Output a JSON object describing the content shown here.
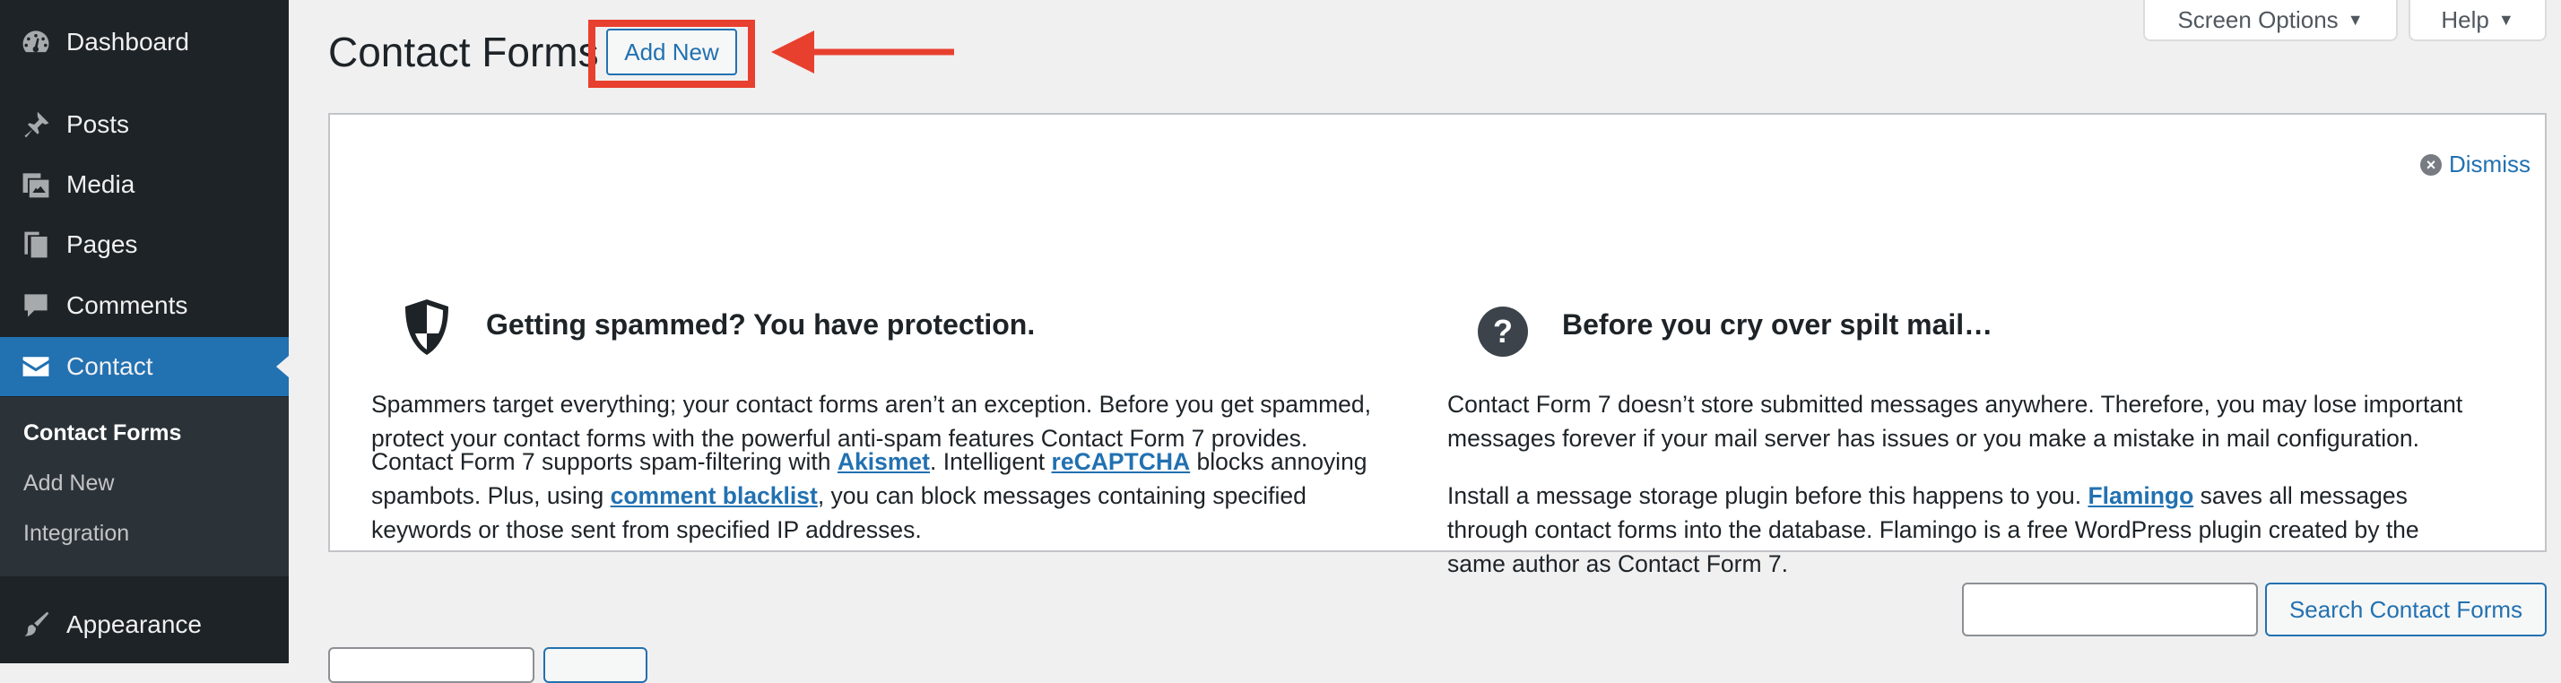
{
  "sidebar": {
    "items": [
      {
        "label": "Dashboard",
        "icon": "dashboard-icon"
      },
      {
        "label": "Posts",
        "icon": "pin-icon"
      },
      {
        "label": "Media",
        "icon": "media-icon"
      },
      {
        "label": "Pages",
        "icon": "pages-icon"
      },
      {
        "label": "Comments",
        "icon": "comment-icon"
      },
      {
        "label": "Contact",
        "icon": "mail-icon"
      },
      {
        "label": "Appearance",
        "icon": "brush-icon"
      }
    ],
    "submenu": [
      "Contact Forms",
      "Add New",
      "Integration"
    ],
    "active_item": "Contact",
    "current_submenu": "Contact Forms"
  },
  "header": {
    "title": "Contact Forms",
    "add_new_label": "Add New",
    "screen_options_label": "Screen Options",
    "help_label": "Help"
  },
  "welcome": {
    "dismiss_label": "Dismiss",
    "left": {
      "title": "Getting spammed? You have protection.",
      "icon": "shield-icon",
      "p1": "Spammers target everything; your contact forms aren’t an exception. Before you get spammed, protect your contact forms with the powerful anti-spam features Contact Form 7 provides.",
      "p2_a": "Contact Form 7 supports spam-filtering with ",
      "p2_link1": "Akismet",
      "p2_b": ". Intelligent ",
      "p2_link2": "reCAPTCHA",
      "p2_c": " blocks annoying spambots. Plus, using ",
      "p2_link3": "comment blacklist",
      "p2_d": ", you can block messages containing specified keywords or those sent from specified IP addresses."
    },
    "right": {
      "title": "Before you cry over spilt mail…",
      "icon": "question-icon",
      "p1": "Contact Form 7 doesn’t store submitted messages anywhere. Therefore, you may lose important messages forever if your mail server has issues or you make a mistake in mail configuration.",
      "p2_a": "Install a message storage plugin before this happens to you. ",
      "p2_link1": "Flamingo",
      "p2_b": " saves all messages through contact forms into the database. Flamingo is a free WordPress plugin created by the same author as Contact Form 7."
    }
  },
  "search": {
    "input_value": "",
    "button_label": "Search Contact Forms"
  },
  "colors": {
    "sidebar_bg": "#1d2327",
    "accent": "#2271b1",
    "annotation_red": "#e8402e"
  }
}
